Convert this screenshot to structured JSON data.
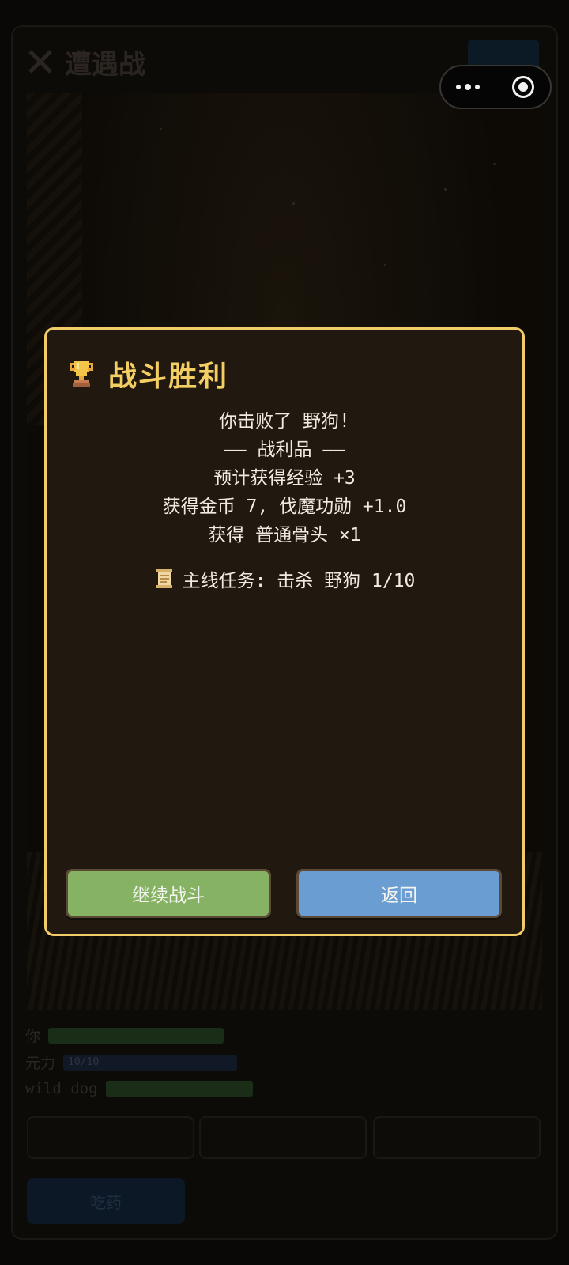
{
  "game": {
    "title": "遭遇战",
    "time_badge": "",
    "stats": [
      {
        "label": "你",
        "value": "",
        "color": "#1f3a1a"
      },
      {
        "label": "元力",
        "value": "10/10",
        "color": "#141c2a"
      },
      {
        "label": "wild_dog",
        "value": "",
        "color": "#1f3a1a"
      }
    ],
    "skills": [
      "",
      "",
      ""
    ],
    "potion_label": "吃药"
  },
  "capsule": {
    "more_icon": "more-dots-icon",
    "close_icon": "target-close-icon"
  },
  "modal": {
    "title": "战斗胜利",
    "title_icon": "trophy-icon",
    "lines": [
      "你击败了 野狗!",
      "—— 战利品 ——",
      "预计获得经验 +3",
      "获得金币 7, 伐魔功勋 +1.0",
      "获得 普通骨头 ×1"
    ],
    "quest_icon": "scroll-icon",
    "quest_text": "主线任务: 击杀 野狗 1/10",
    "continue_label": "继续战斗",
    "back_label": "返回",
    "colors": {
      "border": "#f0cd6a",
      "title": "#f3ce63",
      "continue": "#86b263",
      "back": "#6a9ed2"
    }
  }
}
